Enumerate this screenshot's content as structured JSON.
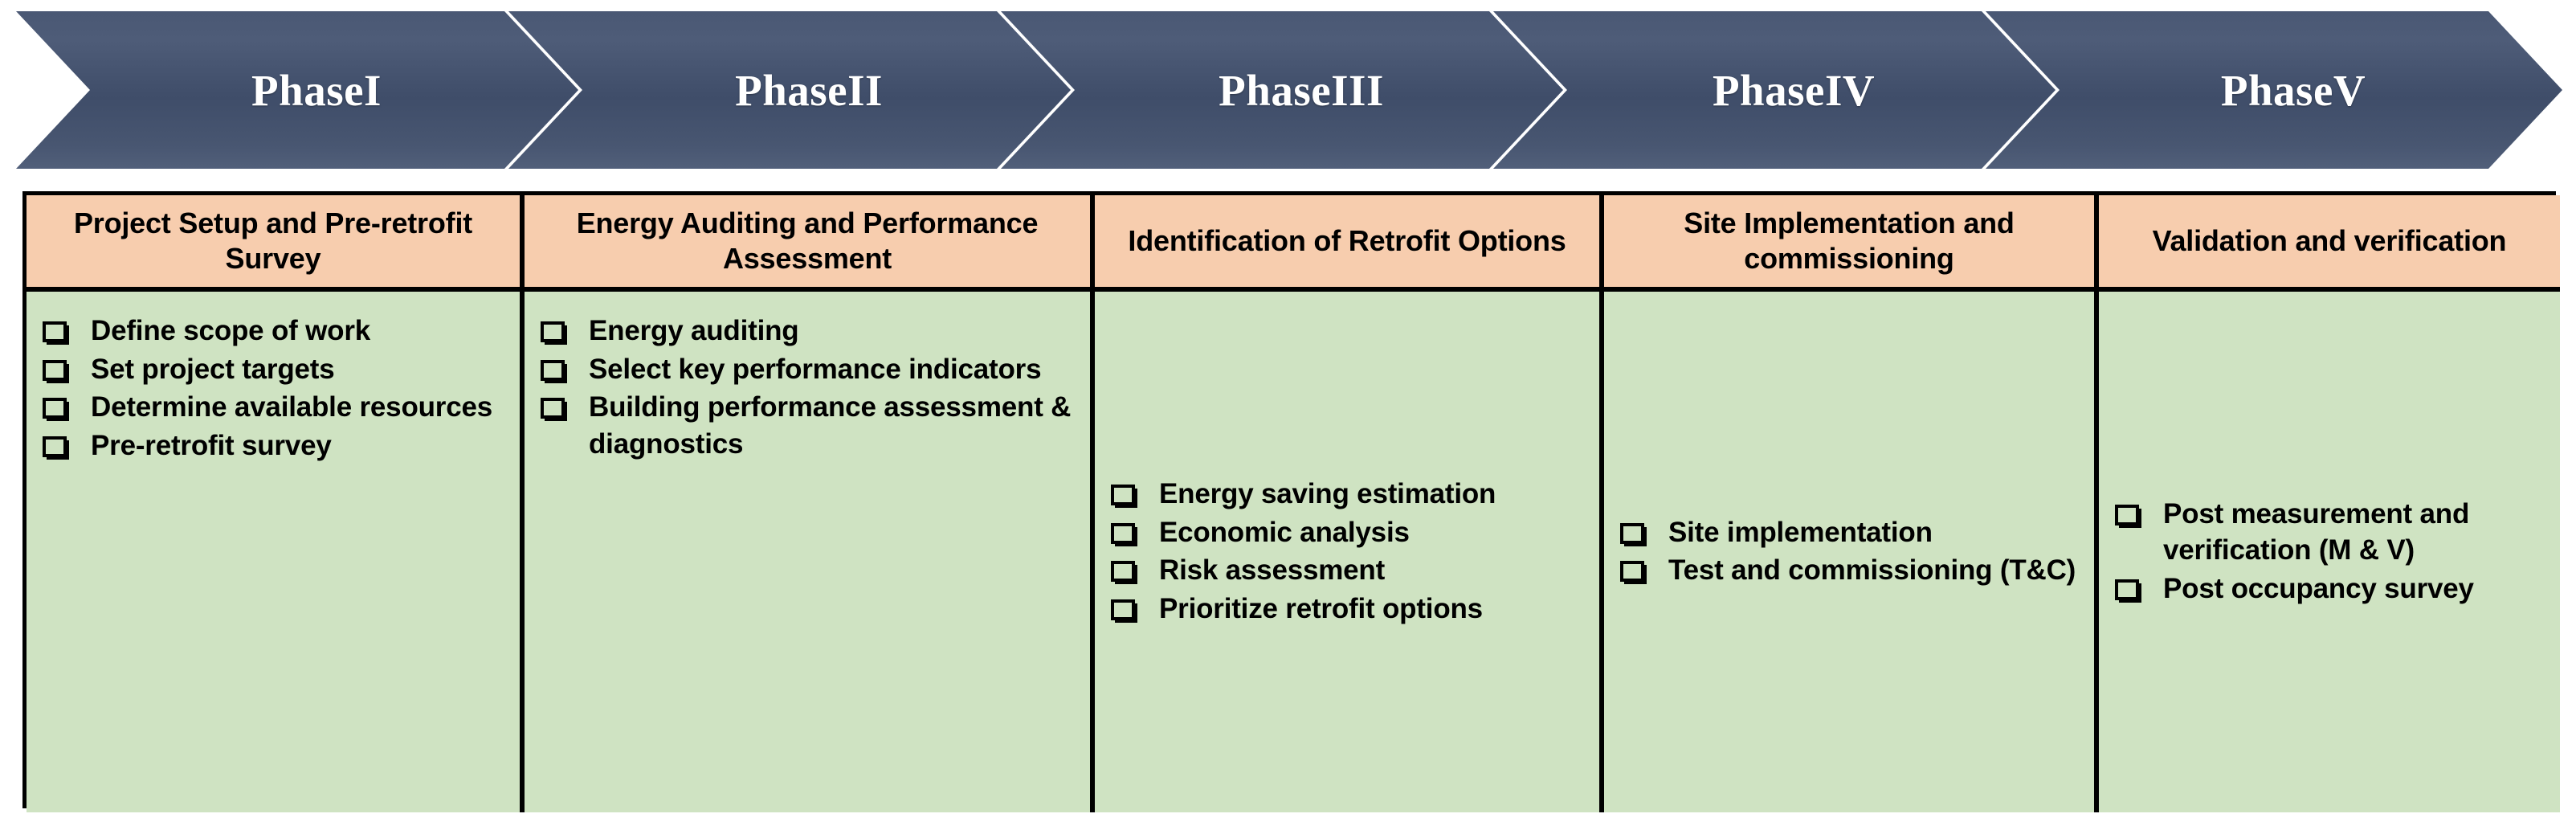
{
  "colors": {
    "chevron_fill": "#47556f",
    "header_fill": "#f7cdae",
    "body_fill": "#cfe3c2",
    "border": "#000000",
    "chevron_text": "#ffffff",
    "cell_text": "#000000"
  },
  "banner": {
    "phases": [
      {
        "label": "PhaseI"
      },
      {
        "label": "PhaseII"
      },
      {
        "label": "PhaseIII"
      },
      {
        "label": "PhaseIV"
      },
      {
        "label": "PhaseV"
      }
    ]
  },
  "table": {
    "headers": [
      "Project Setup and Pre-retrofit Survey",
      "Energy Auditing and Performance Assessment",
      "Identification of Retrofit Options",
      "Site Implementation and commissioning",
      "Validation and verification"
    ],
    "columns": [
      {
        "align": "top",
        "items": [
          "Define scope of work",
          "Set project targets",
          "Determine available resources",
          "Pre-retrofit survey"
        ]
      },
      {
        "align": "top",
        "items": [
          "Energy auditing",
          "Select key performance indicators",
          "Building performance assessment & diagnostics"
        ]
      },
      {
        "align": "center",
        "items": [
          "Energy saving estimation",
          "Economic analysis",
          "Risk assessment",
          "Prioritize retrofit options"
        ]
      },
      {
        "align": "center",
        "items": [
          "Site implementation",
          "Test and commissioning (T&C)"
        ]
      },
      {
        "align": "center",
        "items": [
          "Post measurement and verification (M & V)",
          "Post occupancy survey"
        ]
      }
    ]
  }
}
